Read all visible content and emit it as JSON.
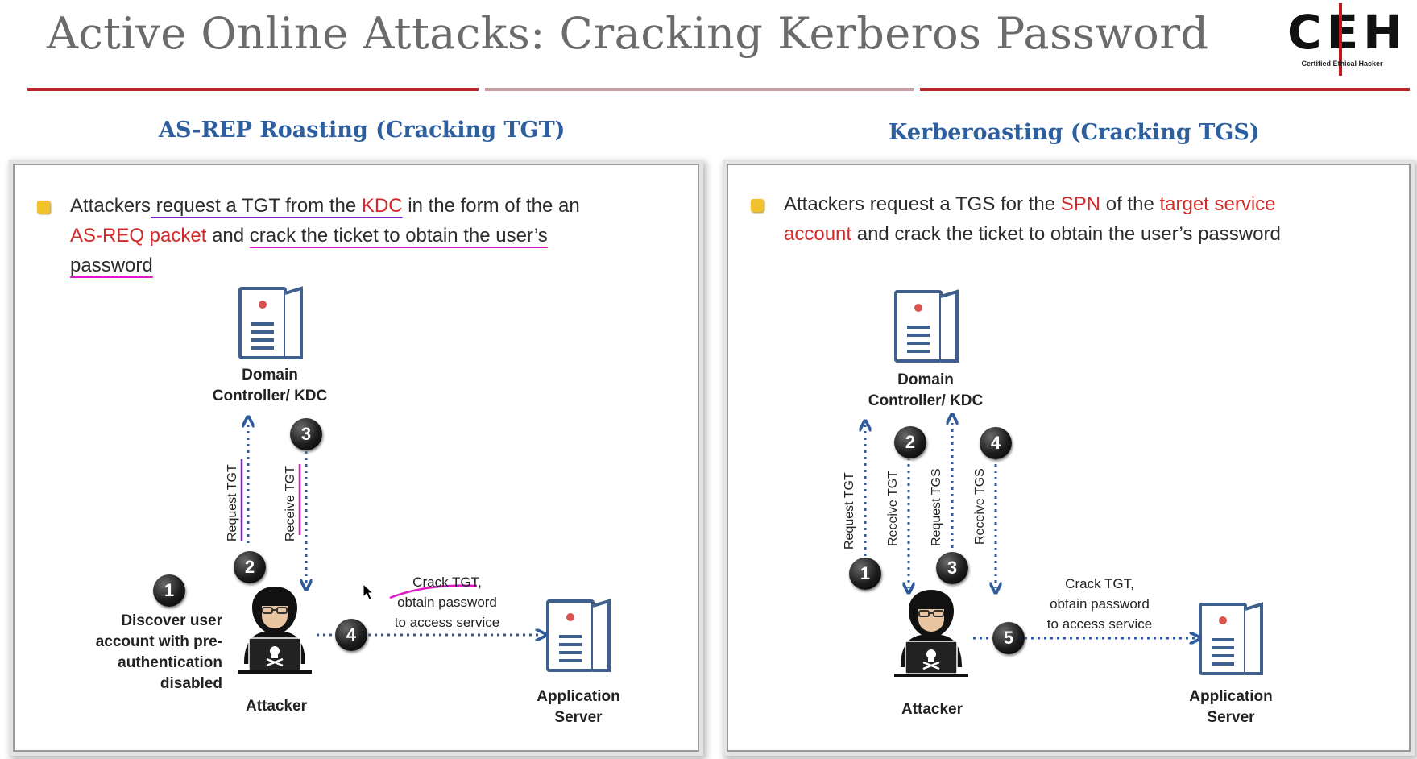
{
  "title": "Active Online Attacks: Cracking Kerberos Password",
  "logo": {
    "letters": "CEH",
    "tagline": "Certified   Ethical   Hacker"
  },
  "left": {
    "heading": "AS-REP Roasting (Cracking TGT)",
    "bullet": {
      "t1": "Attackers",
      "t2": " request a TGT from the ",
      "t3": "KDC",
      "t4": " in the form of the an",
      "t5": "AS-REQ packet",
      "t6": " and ",
      "t7": "crack the ticket to obtain the user’s",
      "t8": "password"
    },
    "dc_label_line1": "Domain",
    "dc_label_line2": "Controller/ KDC",
    "request_label": "Request TGT",
    "receive_label": "Receive TGT",
    "crack_line1": "Crack TGT,",
    "crack_line2": "obtain password",
    "crack_line3": "to access service",
    "discover_line1": "Discover user",
    "discover_line2": "account with pre-",
    "discover_line3": "authentication",
    "discover_line4": "disabled",
    "attacker_label": "Attacker",
    "app_line1": "Application",
    "app_line2": "Server",
    "steps": [
      "1",
      "2",
      "3",
      "4"
    ]
  },
  "right": {
    "heading": "Kerberoasting (Cracking TGS)",
    "bullet": {
      "t1": "Attackers request a TGS for the ",
      "t2": "SPN",
      "t3": " of the ",
      "t4": "target service",
      "t5": "account",
      "t6": " and crack the ticket to obtain the user’s password"
    },
    "dc_label_line1": "Domain",
    "dc_label_line2": "Controller/ KDC",
    "request_tgt_label": "Request TGT",
    "receive_tgt_label": "Receive TGT",
    "request_tgs_label": "Request TGS",
    "receive_tgs_label": "Receive TGS",
    "crack_line1": "Crack TGT,",
    "crack_line2": "obtain password",
    "crack_line3": "to access service",
    "attacker_label": "Attacker",
    "app_line1": "Application",
    "app_line2": "Server",
    "steps": [
      "1",
      "2",
      "3",
      "4",
      "5"
    ]
  },
  "colors": {
    "heading_blue": "#2d5f9e",
    "highlight_red": "#d22a2a",
    "server_blue": "#3f5f8c",
    "arrow_blue": "#2f5b9c",
    "annotation_pink": "#e017c7",
    "annotation_purple": "#7a1fd0",
    "bullet_yellow": "#f2c12e",
    "rule_red": "#b9272c"
  }
}
